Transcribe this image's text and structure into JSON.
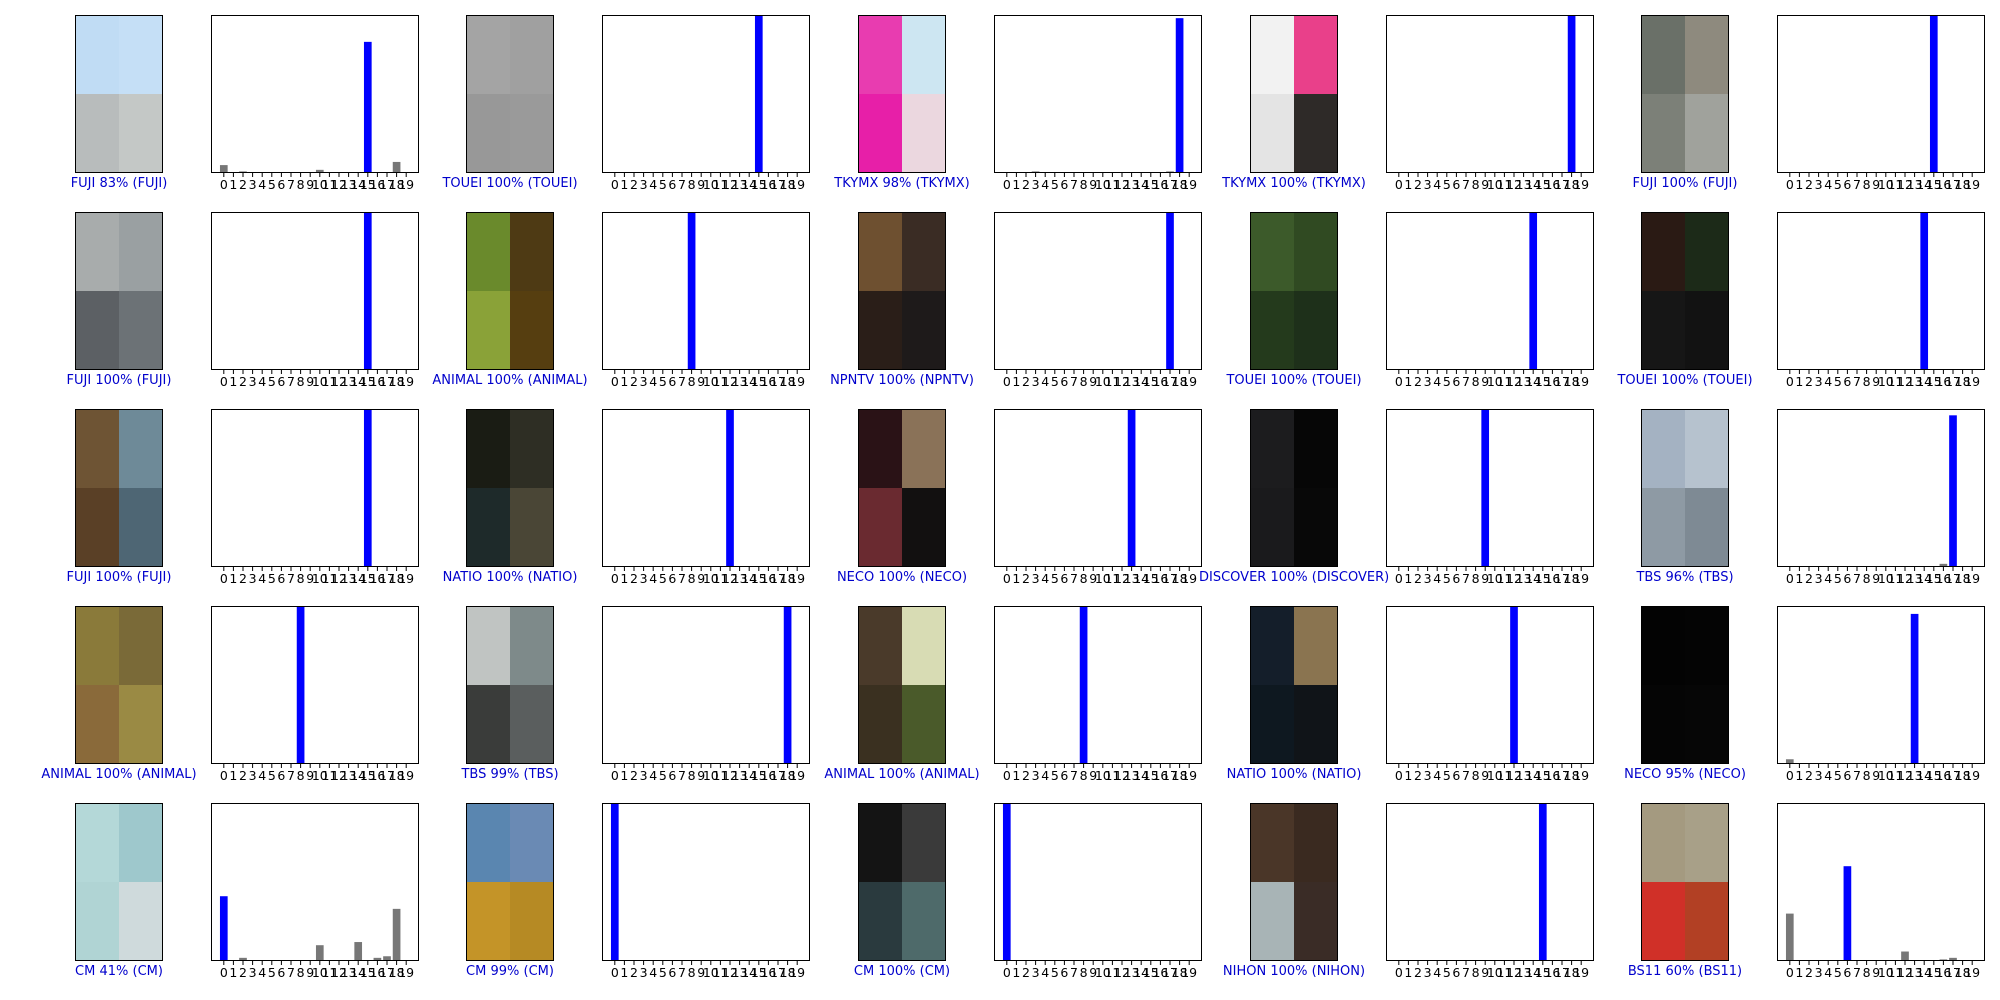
{
  "figure": {
    "tick_labels": [
      "0",
      "1",
      "2",
      "3",
      "4",
      "5",
      "6",
      "7",
      "8",
      "9",
      "10",
      "11",
      "12",
      "13",
      "14",
      "15",
      "16",
      "17",
      "18",
      "19"
    ],
    "predicted_color": "#0000ff",
    "other_color": "#777777",
    "caption_color": "#0000cc"
  },
  "chart_data": [
    {
      "type": "bar",
      "caption": "FUJI 83% (FUJI)",
      "predicted": 15,
      "values": [
        0.05,
        0,
        0.01,
        0,
        0,
        0,
        0,
        0,
        0,
        0,
        0.02,
        0,
        0,
        0,
        0,
        0.83,
        0,
        0,
        0.07,
        0
      ],
      "colors": [
        "#c0dcf4",
        "#c5dff6",
        "#b8bcbc",
        "#c4c8c6"
      ]
    },
    {
      "type": "bar",
      "caption": "TOUEI 100% (TOUEI)",
      "predicted": 15,
      "values": [
        0,
        0,
        0,
        0,
        0,
        0,
        0,
        0,
        0,
        0,
        0,
        0,
        0,
        0,
        0,
        1,
        0,
        0,
        0,
        0
      ],
      "colors": [
        "#a4a4a4",
        "#a0a0a0",
        "#989898",
        "#9a9a9a"
      ]
    },
    {
      "type": "bar",
      "caption": "TKYMX 98% (TKYMX)",
      "predicted": 18,
      "values": [
        0,
        0,
        0,
        0.01,
        0,
        0,
        0,
        0,
        0,
        0,
        0,
        0,
        0,
        0,
        0,
        0,
        0,
        0.01,
        0.98,
        0
      ],
      "colors": [
        "#e83cb0",
        "#cde6f2",
        "#e71fa8",
        "#ebd7df"
      ]
    },
    {
      "type": "bar",
      "caption": "TKYMX 100% (TKYMX)",
      "predicted": 18,
      "values": [
        0,
        0,
        0,
        0,
        0,
        0,
        0,
        0,
        0,
        0,
        0,
        0,
        0,
        0,
        0,
        0,
        0,
        0,
        1,
        0
      ],
      "colors": [
        "#f2f2f2",
        "#e9408a",
        "#e4e4e4",
        "#2e2a28"
      ]
    },
    {
      "type": "bar",
      "caption": "FUJI 100% (FUJI)",
      "predicted": 15,
      "values": [
        0,
        0,
        0,
        0,
        0,
        0,
        0,
        0,
        0,
        0,
        0,
        0,
        0,
        0,
        0,
        1,
        0,
        0,
        0,
        0
      ],
      "colors": [
        "#6a7068",
        "#8e8a7e",
        "#7c8078",
        "#a0a29c"
      ]
    },
    {
      "type": "bar",
      "caption": "FUJI 100% (FUJI)",
      "predicted": 15,
      "values": [
        0,
        0,
        0,
        0,
        0,
        0,
        0,
        0,
        0,
        0,
        0,
        0,
        0,
        0,
        0,
        1,
        0,
        0,
        0,
        0
      ],
      "colors": [
        "#a8acac",
        "#9aa0a2",
        "#5c6064",
        "#6c7276"
      ]
    },
    {
      "type": "bar",
      "caption": "ANIMAL 100% (ANIMAL)",
      "predicted": 8,
      "values": [
        0,
        0,
        0,
        0,
        0,
        0,
        0,
        0,
        1,
        0,
        0,
        0,
        0,
        0,
        0,
        0,
        0,
        0,
        0,
        0
      ],
      "colors": [
        "#6a8a2c",
        "#4e3a14",
        "#8aa238",
        "#563e10"
      ]
    },
    {
      "type": "bar",
      "caption": "NPNTV 100% (NPNTV)",
      "predicted": 17,
      "values": [
        0,
        0,
        0,
        0,
        0,
        0,
        0,
        0,
        0,
        0,
        0,
        0,
        0,
        0,
        0,
        0,
        0,
        1,
        0,
        0
      ],
      "colors": [
        "#6e5030",
        "#3a2c24",
        "#2a1e18",
        "#1e1a1a"
      ]
    },
    {
      "type": "bar",
      "caption": "TOUEI 100% (TOUEI)",
      "predicted": 14,
      "values": [
        0,
        0,
        0,
        0,
        0,
        0,
        0,
        0,
        0,
        0,
        0,
        0,
        0,
        0,
        1,
        0,
        0,
        0,
        0,
        0
      ],
      "colors": [
        "#3c5a2a",
        "#304a22",
        "#243a1c",
        "#1e301a"
      ]
    },
    {
      "type": "bar",
      "caption": "TOUEI 100% (TOUEI)",
      "predicted": 14,
      "values": [
        0,
        0,
        0,
        0,
        0,
        0,
        0,
        0,
        0,
        0,
        0,
        0,
        0,
        0,
        1,
        0,
        0,
        0,
        0,
        0
      ],
      "colors": [
        "#2a1a14",
        "#1c2a18",
        "#161616",
        "#121212"
      ]
    },
    {
      "type": "bar",
      "caption": "FUJI 100% (FUJI)",
      "predicted": 15,
      "values": [
        0,
        0,
        0,
        0,
        0,
        0,
        0,
        0,
        0,
        0,
        0,
        0,
        0,
        0,
        0,
        1,
        0,
        0,
        0,
        0
      ],
      "colors": [
        "#6e5434",
        "#6e8a98",
        "#5a4026",
        "#4e6674"
      ]
    },
    {
      "type": "bar",
      "caption": "NATIO 100% (NATIO)",
      "predicted": 12,
      "values": [
        0,
        0,
        0,
        0,
        0,
        0,
        0,
        0,
        0,
        0,
        0,
        0,
        1,
        0,
        0,
        0,
        0,
        0,
        0,
        0
      ],
      "colors": [
        "#1a1c14",
        "#2e2e24",
        "#1e2a2a",
        "#4a4636"
      ]
    },
    {
      "type": "bar",
      "caption": "NECO 100% (NECO)",
      "predicted": 13,
      "values": [
        0,
        0,
        0,
        0,
        0,
        0,
        0,
        0,
        0,
        0,
        0,
        0,
        0,
        1,
        0,
        0,
        0,
        0,
        0,
        0
      ],
      "colors": [
        "#2a1216",
        "#8a7258",
        "#6a2a30",
        "#121010"
      ]
    },
    {
      "type": "bar",
      "caption": "DISCOVER 100% (DISCOVER)",
      "predicted": 9,
      "values": [
        0,
        0,
        0,
        0,
        0,
        0,
        0,
        0,
        0,
        1,
        0,
        0,
        0,
        0,
        0,
        0,
        0,
        0,
        0,
        0
      ],
      "colors": [
        "#1c1c1e",
        "#060606",
        "#1a1a1c",
        "#080808"
      ]
    },
    {
      "type": "bar",
      "caption": "TBS 96% (TBS)",
      "predicted": 17,
      "values": [
        0,
        0,
        0,
        0,
        0,
        0,
        0,
        0,
        0,
        0,
        0,
        0,
        0,
        0,
        0,
        0,
        0.02,
        0.96,
        0,
        0
      ],
      "colors": [
        "#a4b2c2",
        "#b6c2ce",
        "#8e9aa4",
        "#7e8a94"
      ]
    },
    {
      "type": "bar",
      "caption": "ANIMAL 100% (ANIMAL)",
      "predicted": 8,
      "values": [
        0,
        0,
        0,
        0,
        0,
        0,
        0,
        0,
        1,
        0,
        0,
        0,
        0,
        0,
        0,
        0,
        0,
        0,
        0,
        0
      ],
      "colors": [
        "#8a7a3a",
        "#7a6a38",
        "#8a6a3a",
        "#9a8a44"
      ]
    },
    {
      "type": "bar",
      "caption": "TBS 99% (TBS)",
      "predicted": 18,
      "values": [
        0,
        0,
        0,
        0,
        0,
        0,
        0,
        0,
        0,
        0,
        0,
        0,
        0,
        0,
        0,
        0,
        0,
        0,
        1,
        0
      ],
      "colors": [
        "#c0c4c2",
        "#7e8a8a",
        "#3a3c3a",
        "#5a5e5e"
      ]
    },
    {
      "type": "bar",
      "caption": "ANIMAL 100% (ANIMAL)",
      "predicted": 8,
      "values": [
        0,
        0,
        0,
        0,
        0,
        0,
        0,
        0,
        1,
        0,
        0,
        0,
        0,
        0,
        0,
        0,
        0,
        0,
        0,
        0
      ],
      "colors": [
        "#4a3a2a",
        "#d8dcb4",
        "#3a3020",
        "#4a5a2a"
      ]
    },
    {
      "type": "bar",
      "caption": "NATIO 100% (NATIO)",
      "predicted": 12,
      "values": [
        0,
        0,
        0,
        0,
        0,
        0,
        0,
        0,
        0,
        0,
        0,
        0,
        1,
        0,
        0,
        0,
        0,
        0,
        0,
        0
      ],
      "colors": [
        "#141e2a",
        "#8a7450",
        "#0e1820",
        "#101418"
      ]
    },
    {
      "type": "bar",
      "caption": "NECO 95% (NECO)",
      "predicted": 13,
      "values": [
        0.03,
        0,
        0,
        0,
        0,
        0,
        0,
        0,
        0,
        0,
        0,
        0,
        0,
        0.95,
        0,
        0,
        0,
        0,
        0,
        0
      ],
      "colors": [
        "#030303",
        "#040404",
        "#050505",
        "#060606"
      ]
    },
    {
      "type": "bar",
      "caption": "CM 41% (CM)",
      "predicted": 0,
      "values": [
        0.41,
        0,
        0.02,
        0,
        0,
        0,
        0,
        0,
        0,
        0,
        0.1,
        0,
        0,
        0,
        0.12,
        0,
        0.02,
        0.03,
        0.33,
        0
      ],
      "colors": [
        "#b4d8d8",
        "#9ec8cc",
        "#b0d4d4",
        "#cfdadc"
      ]
    },
    {
      "type": "bar",
      "caption": "CM 99% (CM)",
      "predicted": 0,
      "values": [
        1,
        0,
        0,
        0,
        0,
        0,
        0,
        0,
        0,
        0,
        0,
        0,
        0,
        0,
        0,
        0,
        0,
        0,
        0,
        0
      ],
      "colors": [
        "#5a86b0",
        "#6a8ab4",
        "#c49428",
        "#b68a24"
      ]
    },
    {
      "type": "bar",
      "caption": "CM 100% (CM)",
      "predicted": 0,
      "values": [
        1,
        0,
        0,
        0,
        0,
        0,
        0,
        0,
        0,
        0,
        0,
        0,
        0,
        0,
        0,
        0,
        0,
        0,
        0,
        0
      ],
      "colors": [
        "#141414",
        "#3a3a3a",
        "#2a3a3e",
        "#4e6a6a"
      ]
    },
    {
      "type": "bar",
      "caption": "NIHON 100% (NIHON)",
      "predicted": 15,
      "values": [
        0,
        0,
        0,
        0,
        0,
        0,
        0,
        0,
        0,
        0,
        0,
        0,
        0,
        0,
        0,
        1,
        0,
        0,
        0,
        0
      ],
      "colors": [
        "#4a3628",
        "#3a2a20",
        "#a8b4b6",
        "#3a2c26"
      ]
    },
    {
      "type": "bar",
      "caption": "BS11 60% (BS11)",
      "predicted": 6,
      "values": [
        0.3,
        0,
        0,
        0,
        0,
        0,
        0.6,
        0,
        0,
        0,
        0,
        0,
        0.06,
        0,
        0,
        0,
        0.01,
        0.02,
        0,
        0
      ],
      "colors": [
        "#a49a80",
        "#a8a088",
        "#d03028",
        "#b24024"
      ]
    }
  ]
}
